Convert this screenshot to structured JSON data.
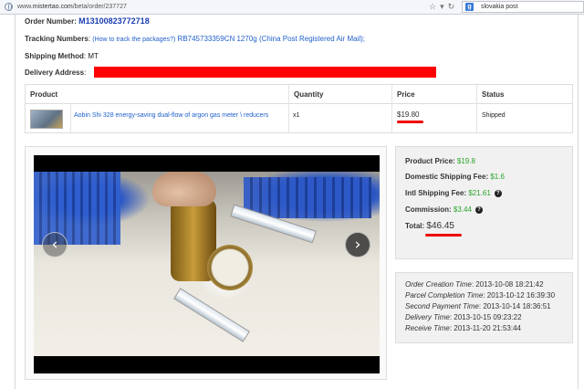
{
  "browser": {
    "url_prefix": "www.",
    "url_domain": "mistertao.com",
    "url_path": "/beta/order/237727",
    "search_query": "slovakia post"
  },
  "order": {
    "number_label": "Order Number",
    "number": "M13100823772718",
    "tracking_label": "Tracking Numbers",
    "tracking_help": "(How to track the packages?)",
    "tracking_value": "RB745733359CN 1270g (China Post Registered Air Mail);",
    "shipping_label": "Shipping Method",
    "shipping_value": "MT",
    "delivery_label": "Delivery Address"
  },
  "table": {
    "headers": [
      "Product",
      "Quantity",
      "Price",
      "Status"
    ],
    "row": {
      "product": "Aobin Shi 328 energy-saving dual-flow of argon gas meter \\ reducers",
      "quantity": "x1",
      "price": "$19.80",
      "status": "Shipped"
    }
  },
  "fees": {
    "product_price_label": "Product Price",
    "product_price": "$19.8",
    "domestic_label": "Domestic Shipping Fee",
    "domestic": "$1.6",
    "intl_label": "Intl Shipping Fee",
    "intl": "$21.61",
    "commission_label": "Commission",
    "commission": "$3.44",
    "total_label": "Total",
    "total": "$46.45"
  },
  "times": [
    {
      "label": "Order Creation Time",
      "value": "2013-10-08 18:21:42"
    },
    {
      "label": "Parcel Completion Time",
      "value": "2013-10-12 16:39:30"
    },
    {
      "label": "Second Payment Time",
      "value": "2013-10-14 18:36:51"
    },
    {
      "label": "Delivery Time",
      "value": "2013-10-15 09:23:22"
    },
    {
      "label": "Receive Time",
      "value": "2013-11-20 21:53:44"
    }
  ],
  "slideshow": {
    "prev_glyph": "‹",
    "next_glyph": "›"
  },
  "colors": {
    "accent_link": "#1f5fcc",
    "price_green": "#2aa52a",
    "highlight_red": "#ff0000"
  }
}
